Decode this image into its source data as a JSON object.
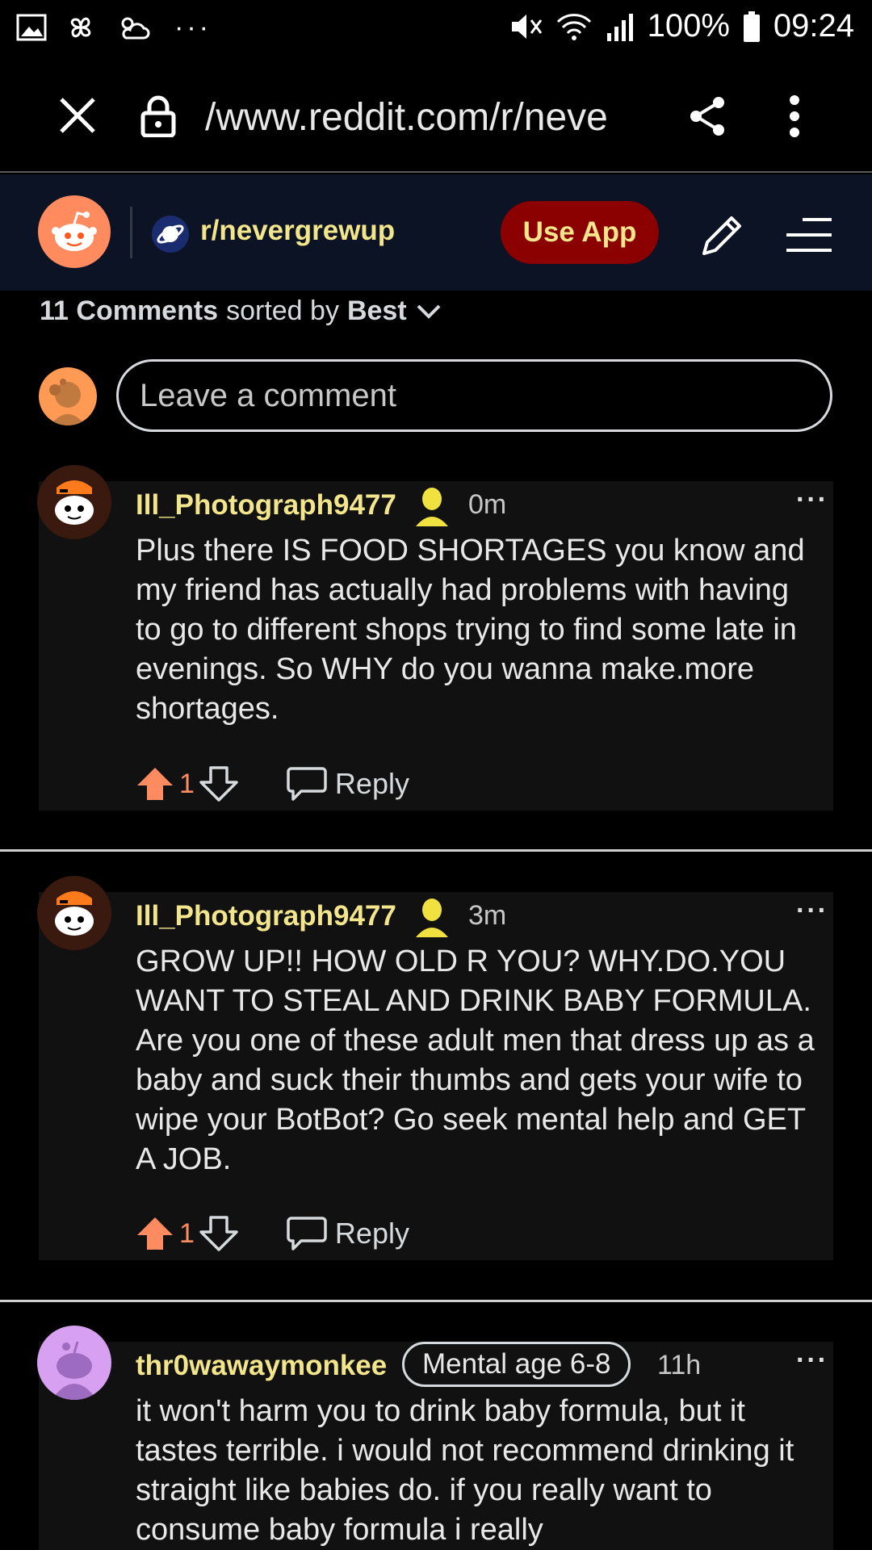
{
  "status_bar": {
    "battery": "100%",
    "time": "09:24",
    "more_icons": "···"
  },
  "browser": {
    "url": "/www.reddit.com/r/neve"
  },
  "header": {
    "subreddit": "r/nevergrewup",
    "use_app_label": "Use App"
  },
  "sort": {
    "count_label": "11 Comments",
    "sorted_by_label": "sorted by",
    "sort_value": "Best"
  },
  "compose": {
    "placeholder": "Leave a comment"
  },
  "comments": [
    {
      "username": "Ill_Photograph9477",
      "time": "0m",
      "body": "Plus there IS FOOD SHORTAGES you know and my friend has actually had problems with having to go to different shops trying to find some late in evenings. So WHY do you wanna make.more shortages.",
      "score": "1",
      "reply_label": "Reply",
      "more": "···"
    },
    {
      "username": "Ill_Photograph9477",
      "time": "3m",
      "body": "GROW UP!! HOW OLD R YOU? WHY.DO.YOU WANT TO STEAL AND DRINK BABY FORMULA. Are you one of these adult men that dress up as a baby and suck their thumbs and gets your wife to wipe your BotBot? Go seek mental help and GET A JOB.",
      "score": "1",
      "reply_label": "Reply",
      "more": "···"
    },
    {
      "username": "thr0wawaymonkee",
      "flair": "Mental age 6-8",
      "time": "11h",
      "body": "it won't harm you to drink baby formula, but it tastes terrible. i would not recommend drinking it straight like babies do. if you really want to consume baby formula i really",
      "more": "···"
    }
  ],
  "colors": {
    "accent_yellow": "#f2e58c",
    "upvote_orange": "#ff8b60",
    "use_app_bg": "#8b0000",
    "header_bg": "#0b1325"
  }
}
